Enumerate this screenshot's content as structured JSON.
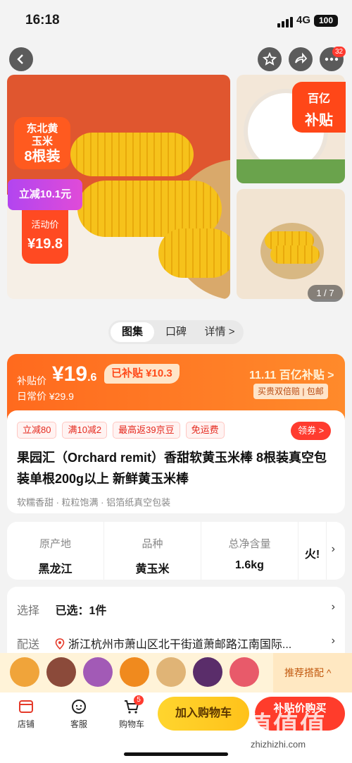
{
  "status_bar": {
    "time": "16:18",
    "network": "4G",
    "battery": "100"
  },
  "nav": {
    "notification_count": "32"
  },
  "gallery": {
    "tag_line1": "东北黄玉米",
    "tag_line2": "8根装",
    "discount": "立减10.1元",
    "promo_label": "活动价",
    "promo_price": "¥19.8",
    "subsidy_line1": "百亿",
    "subsidy_line2": "补贴",
    "counter": "1 / 7"
  },
  "tabs": [
    "图集",
    "口碑",
    "详情 >"
  ],
  "price_banner": {
    "subsidy_label": "补贴价",
    "price_main": "¥19",
    "price_decimal": ".6",
    "regular": "日常价 ¥29.9",
    "saved": "已补贴 ¥10.3",
    "brand": "11.11 百亿补贴 >",
    "guarantee": "买贵双倍赔 | 包邮"
  },
  "product": {
    "promos": [
      "立减80",
      "满10减2",
      "最高返39京豆",
      "免运费"
    ],
    "coupon": "领券 >",
    "title": "果园汇（Orchard remit）香甜软黄玉米棒 8根装真空包装单根200g以上 新鲜黄玉米棒",
    "features": "软糯香甜 · 粒粒饱满 · 铝箔纸真空包装"
  },
  "specs": [
    {
      "key": "原产地",
      "value": "黑龙江"
    },
    {
      "key": "品种",
      "value": "黄玉米"
    },
    {
      "key": "总净含量",
      "value": "1.6kg"
    },
    {
      "key": "",
      "value": "火ǃ"
    }
  ],
  "selection": {
    "label": "选择",
    "value": "已选：1件"
  },
  "delivery": {
    "label": "配送",
    "value": "浙江杭州市萧山区北干街道萧邮路江南国际..."
  },
  "recommend": {
    "label": "推荐搭配 ^"
  },
  "bottom": {
    "shop": "店铺",
    "service": "客服",
    "cart": "购物车",
    "cart_count": "5",
    "add_cart": "加入购物车",
    "buy": "补贴价购买"
  },
  "watermark": {
    "text": "值值值",
    "url": "zhizhizhi.com"
  }
}
